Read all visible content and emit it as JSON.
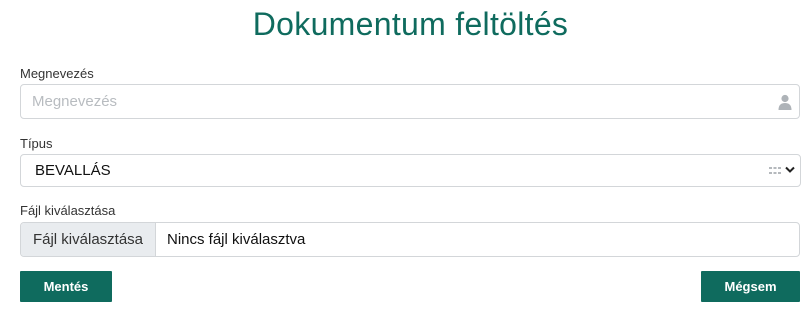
{
  "page": {
    "title": "Dokumentum feltöltés"
  },
  "form": {
    "name": {
      "label": "Megnevezés",
      "placeholder": "Megnevezés",
      "value": "",
      "icon": "user-icon"
    },
    "type": {
      "label": "Típus",
      "selected": "BEVALLÁS",
      "icons": [
        "grid-icon",
        "chevron-down-icon"
      ]
    },
    "file": {
      "label": "Fájl kiválasztása",
      "button_label": "Fájl kiválasztása",
      "status": "Nincs fájl kiválasztva"
    }
  },
  "actions": {
    "save_label": "Mentés",
    "cancel_label": "Mégsem"
  },
  "colors": {
    "accent": "#0f6b5e",
    "border": "#d3d6d9",
    "file_button_bg": "#e9ecef"
  }
}
